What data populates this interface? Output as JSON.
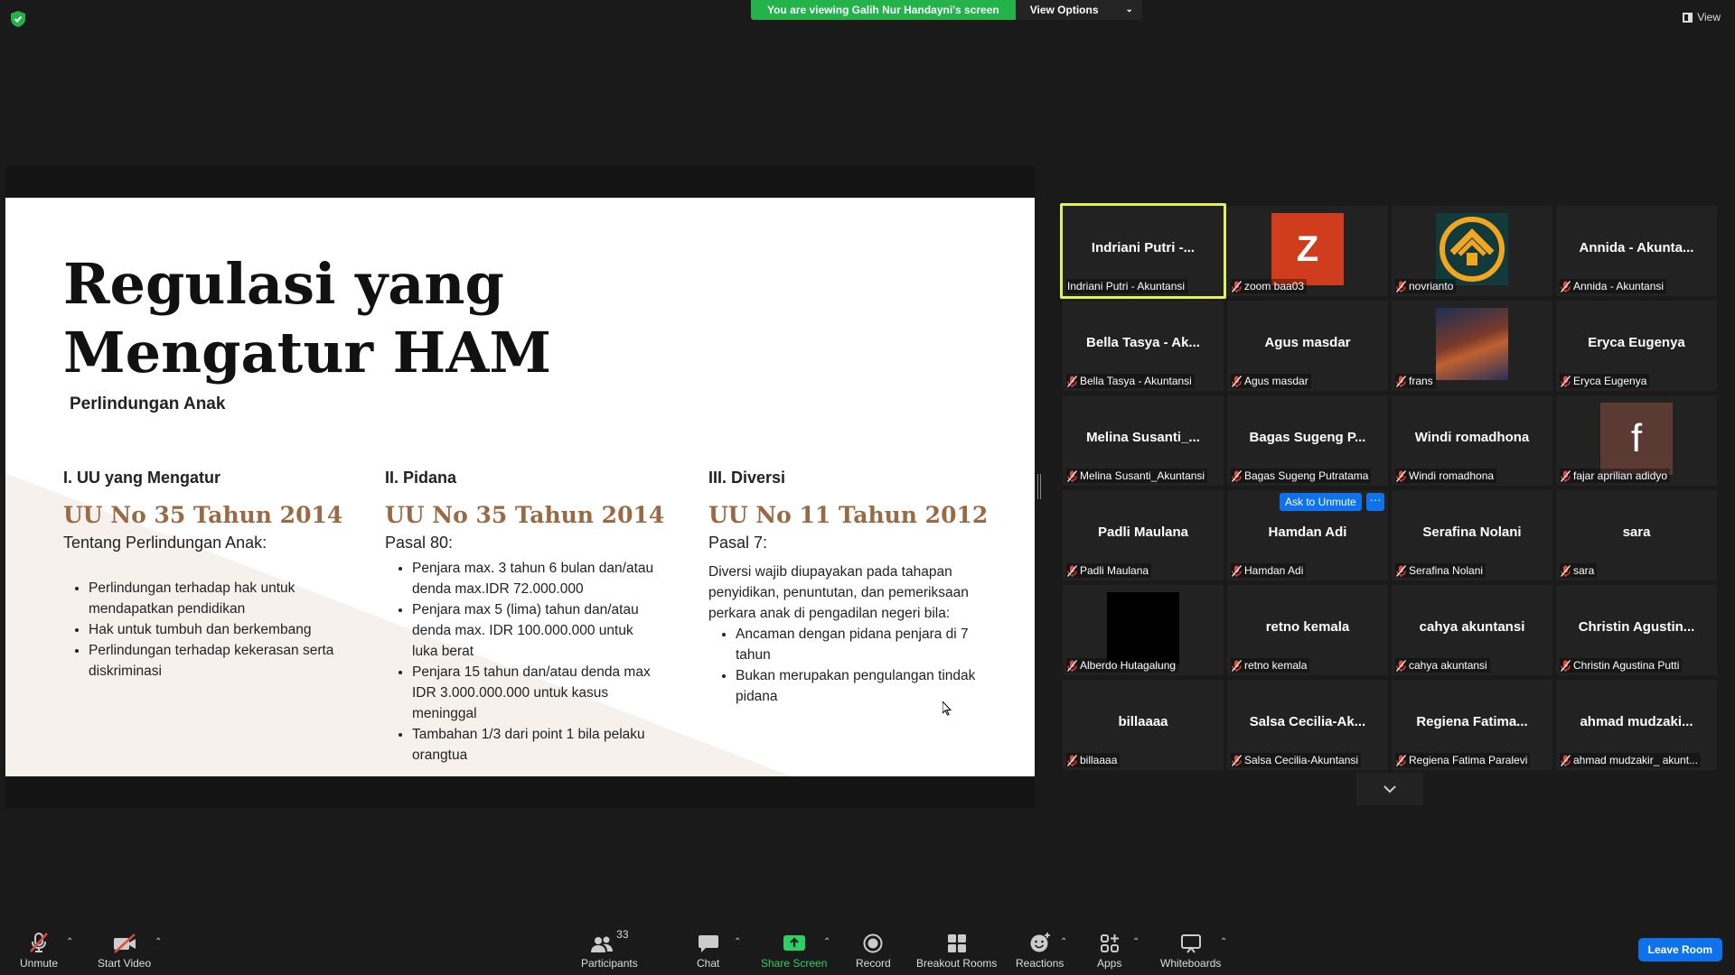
{
  "top": {
    "viewing_text": "You are viewing Galih Nur Handayni's screen",
    "view_options": "View Options",
    "view": "View"
  },
  "slide": {
    "title": "Regulasi yang Mengatur HAM",
    "subtitle": "Perlindungan Anak",
    "columns": [
      {
        "heading": "I. UU yang Mengatur",
        "law": "UU No 35 Tahun 2014",
        "lead": "Tentang Perlindungan Anak:",
        "items": [
          "Perlindungan terhadap hak untuk mendapatkan pendidikan",
          "Hak untuk tumbuh dan berkembang",
          "Perlindungan terhadap kekerasan serta diskriminasi"
        ]
      },
      {
        "heading": "II. Pidana",
        "law": "UU No 35 Tahun 2014",
        "lead": "Pasal 80:",
        "items": [
          "Penjara max. 3 tahun 6 bulan dan/atau denda max.IDR 72.000.000",
          "Penjara max 5 (lima) tahun dan/atau denda max. IDR 100.000.000 untuk luka berat",
          "Penjara 15 tahun dan/atau denda max IDR 3.000.000.000 untuk kasus meninggal",
          "Tambahan 1/3 dari point 1 bila pelaku orangtua"
        ]
      },
      {
        "heading": "III. Diversi",
        "law": "UU No 11 Tahun 2012",
        "lead": "Pasal 7:",
        "body": "Diversi wajib diupayakan pada tahapan penyidikan, penuntutan, dan pemeriksaan perkara anak di pengadilan negeri bila:",
        "items": [
          "Ancaman dengan pidana penjara di 7 tahun",
          "Bukan merupakan pengulangan tindak pidana"
        ]
      }
    ]
  },
  "gallery": [
    {
      "center": "Indriani  Putri  -...",
      "label": "Indriani Putri - Akuntansi",
      "active": true,
      "muted": false
    },
    {
      "avatar": "z",
      "avatar_text": "Z",
      "label": "zoom baa03",
      "muted": true
    },
    {
      "avatar": "logo",
      "label": "novrianto",
      "muted": true
    },
    {
      "center": "Annida  -  Akunta...",
      "label": "Annida - Akuntansi",
      "muted": true
    },
    {
      "center": "Bella Tasya - Ak...",
      "label": "Bella Tasya - Akuntansi",
      "muted": true
    },
    {
      "center": "Agus masdar",
      "label": "Agus masdar",
      "muted": true
    },
    {
      "avatar": "photo",
      "label": "frans",
      "muted": true
    },
    {
      "center": "Eryca Eugenya",
      "label": "Eryca Eugenya",
      "muted": true
    },
    {
      "center": "Melina  Susanti_...",
      "label": "Melina Susanti_Akuntansi",
      "muted": true
    },
    {
      "center": "Bagas  Sugeng  P...",
      "label": "Bagas Sugeng Putratama",
      "muted": true
    },
    {
      "center": "Windi romadhona",
      "label": "Windi romadhona",
      "muted": true
    },
    {
      "avatar": "f",
      "avatar_text": "f",
      "label": "fajar aprilian adidyo",
      "muted": true
    },
    {
      "center": "Padli Maulana",
      "label": "Padli Maulana",
      "muted": true
    },
    {
      "center": "Hamdan Adi",
      "label": "Hamdan Adi",
      "muted": true
    },
    {
      "center": "Serafina Nolani",
      "label": "Serafina Nolani",
      "muted": true
    },
    {
      "center": "sara",
      "label": "sara",
      "muted": true
    },
    {
      "avatar": "black",
      "label": "Alberdo Hutagalung",
      "muted": true
    },
    {
      "center": "retno kemala",
      "label": "retno kemala",
      "muted": true
    },
    {
      "center": "cahya akuntansi",
      "label": "cahya akuntansi",
      "muted": true
    },
    {
      "center": "Christin  Agustin...",
      "label": "Christin Agustina Putti",
      "muted": true
    },
    {
      "center": "billaaaa",
      "label": "billaaaa",
      "muted": true
    },
    {
      "center": "Salsa  Cecilia-Ak...",
      "label": "Salsa Cecilia-Akuntansi",
      "muted": true
    },
    {
      "center": "Regiena  Fatima...",
      "label": "Regiena Fatima Paralevi",
      "muted": true
    },
    {
      "center": "ahmad  mudzaki...",
      "label": "ahmad mudzakir_ akunt...",
      "muted": true
    }
  ],
  "ask_to_unmute": "Ask to Unmute",
  "more": "···",
  "toolbar": {
    "unmute": "Unmute",
    "start_video": "Start Video",
    "participants": "Participants",
    "participants_count": "33",
    "chat": "Chat",
    "share_screen": "Share Screen",
    "record": "Record",
    "breakout_rooms": "Breakout Rooms",
    "reactions": "Reactions",
    "apps": "Apps",
    "whiteboards": "Whiteboards",
    "leave": "Leave Room"
  },
  "colors": {
    "share_green": "#24b24b",
    "active_speaker": "#e2f34a",
    "accent_blue": "#0e72ed",
    "law_brown": "#9a6a45"
  }
}
